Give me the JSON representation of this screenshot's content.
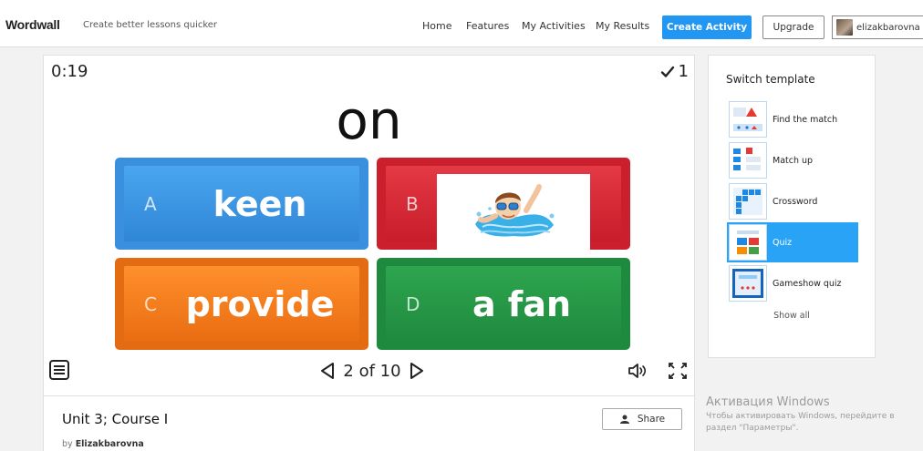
{
  "header": {
    "logo": "Wordwall",
    "tagline": "Create better lessons quicker",
    "nav": [
      "Home",
      "Features",
      "My Activities",
      "My Results"
    ],
    "create_label": "Create Activity",
    "upgrade_label": "Upgrade",
    "username": "elizakbarovna"
  },
  "game": {
    "timer": "0:19",
    "score": "1",
    "question": "on",
    "answers": [
      {
        "letter": "A",
        "text": "keen",
        "color": "#3a8fde"
      },
      {
        "letter": "B",
        "text": "",
        "image": "swimming-boy-image",
        "color": "#cc1f2e"
      },
      {
        "letter": "C",
        "text": "provide",
        "color": "#e36c12"
      },
      {
        "letter": "D",
        "text": "a fan",
        "color": "#1e8a3e"
      }
    ],
    "pager": "2 of 10"
  },
  "info": {
    "title": "Unit 3; Course I",
    "by_prefix": "by",
    "author": "Elizakbarovna",
    "share_label": "Share"
  },
  "sidebar": {
    "title": "Switch template",
    "templates": [
      {
        "label": "Find the match",
        "active": false
      },
      {
        "label": "Match up",
        "active": false
      },
      {
        "label": "Crossword",
        "active": false
      },
      {
        "label": "Quiz",
        "active": true
      },
      {
        "label": "Gameshow quiz",
        "active": false
      }
    ],
    "show_all": "Show all"
  },
  "watermark": {
    "title": "Активация Windows",
    "line1": "Чтобы активировать Windows, перейдите в",
    "line2": "раздел \"Параметры\"."
  },
  "colors": {
    "accent": "#2196f3",
    "active_template": "#29a3f5"
  }
}
